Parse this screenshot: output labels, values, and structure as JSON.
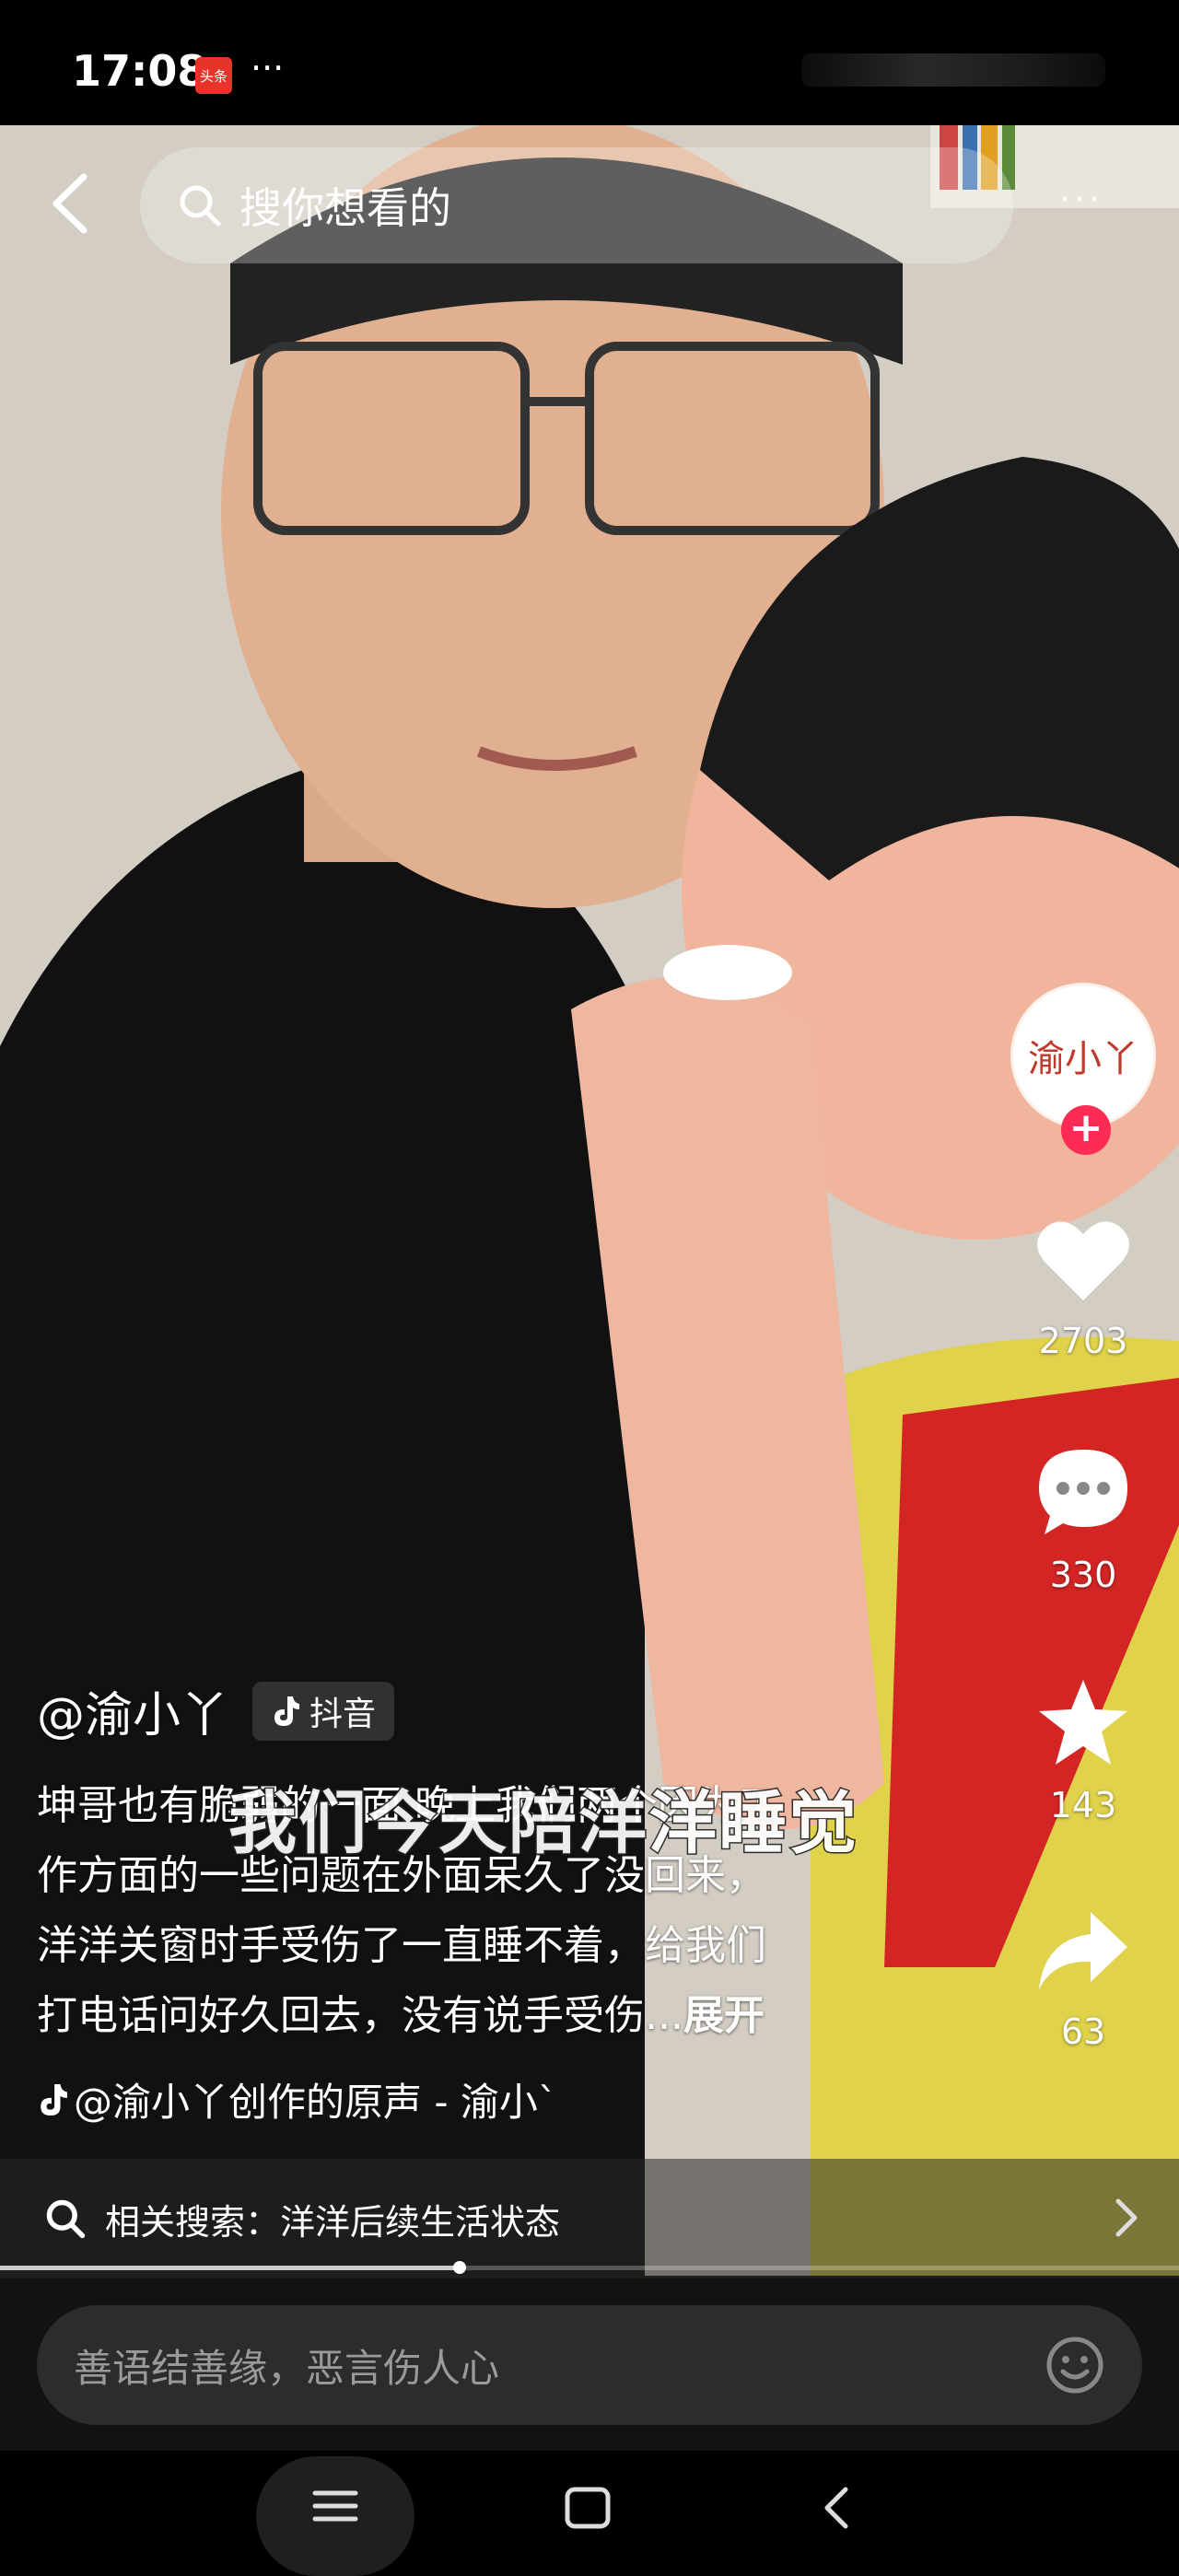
{
  "status_bar": {
    "time": "17:08",
    "app_badge": "头条",
    "more": "···"
  },
  "search": {
    "placeholder": "搜你想看的"
  },
  "video": {
    "subtitle": "我们今天陪洋洋睡觉"
  },
  "creator": {
    "avatar_text": "渝小丫",
    "follow_symbol": "+"
  },
  "actions": {
    "likes": "2703",
    "comments": "330",
    "favorites": "143",
    "shares": "63"
  },
  "caption": {
    "author": "@渝小丫",
    "platform": "抖音",
    "lines": [
      "坤哥也有脆弱的一面 晚上我们两个因为工",
      "作方面的一些问题在外面呆久了没回来，",
      "洋洋关窗时手受伤了一直睡不着，给我们",
      "打电话问好久回去，没有说手受伤..."
    ],
    "expand": "展开",
    "music": "@渝小丫创作的原声 - 渝小`"
  },
  "related": {
    "label": "相关搜索：洋洋后续生活状态"
  },
  "progress": {
    "fraction": 0.39
  },
  "comment": {
    "placeholder": "善语结善缘，恶言伤人心"
  },
  "colors": {
    "accent": "#fe2c55",
    "like": "#ffffff"
  }
}
